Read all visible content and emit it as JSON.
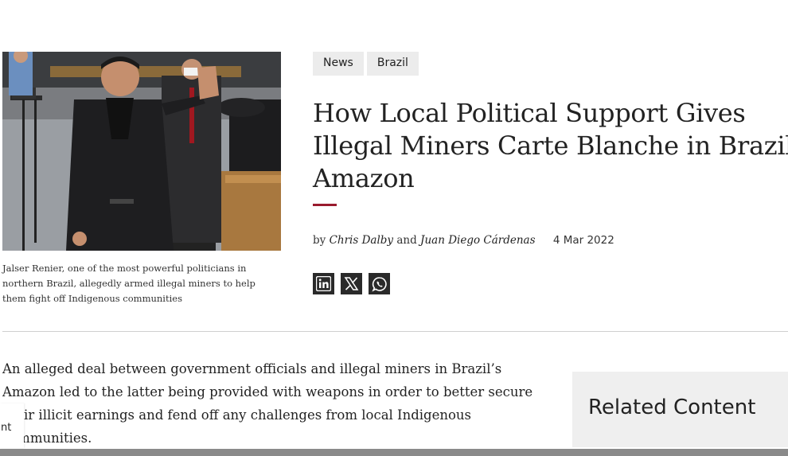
{
  "article": {
    "tags": [
      "News",
      "Brazil"
    ],
    "headline_lines": [
      "How Local Political Support Gives",
      "Illegal Miners Carte Blanche in Brazil’s",
      "Amazon"
    ],
    "byline": {
      "prefix": "by",
      "author1": "Chris Dalby",
      "conjunction": "and",
      "author2": "Juan Diego Cárdenas",
      "date": "4 Mar 2022"
    },
    "caption": "Jalser Renier, one of the most powerful politicians in northern Brazil, allegedly armed illegal miners to help them fight off Indigenous communities",
    "share": [
      {
        "icon": "linkedin-icon"
      },
      {
        "icon": "x-twitter-icon"
      },
      {
        "icon": "whatsapp-icon"
      }
    ],
    "body_lines": [
      "An alleged deal between government officials and illegal miners in Brazil’s",
      "Amazon led to the latter being provided with weapons in order to better secure",
      "their illicit earnings and fend off any challenges from local Indigenous",
      "communities."
    ]
  },
  "sidebar": {
    "related_title": "Related Content"
  },
  "overlay": {
    "label": "nt"
  },
  "colors": {
    "accent": "#9a1b2e",
    "tag_bg": "#ececec",
    "related_bg": "#efefef",
    "icon_bg": "#2a2a2a"
  }
}
